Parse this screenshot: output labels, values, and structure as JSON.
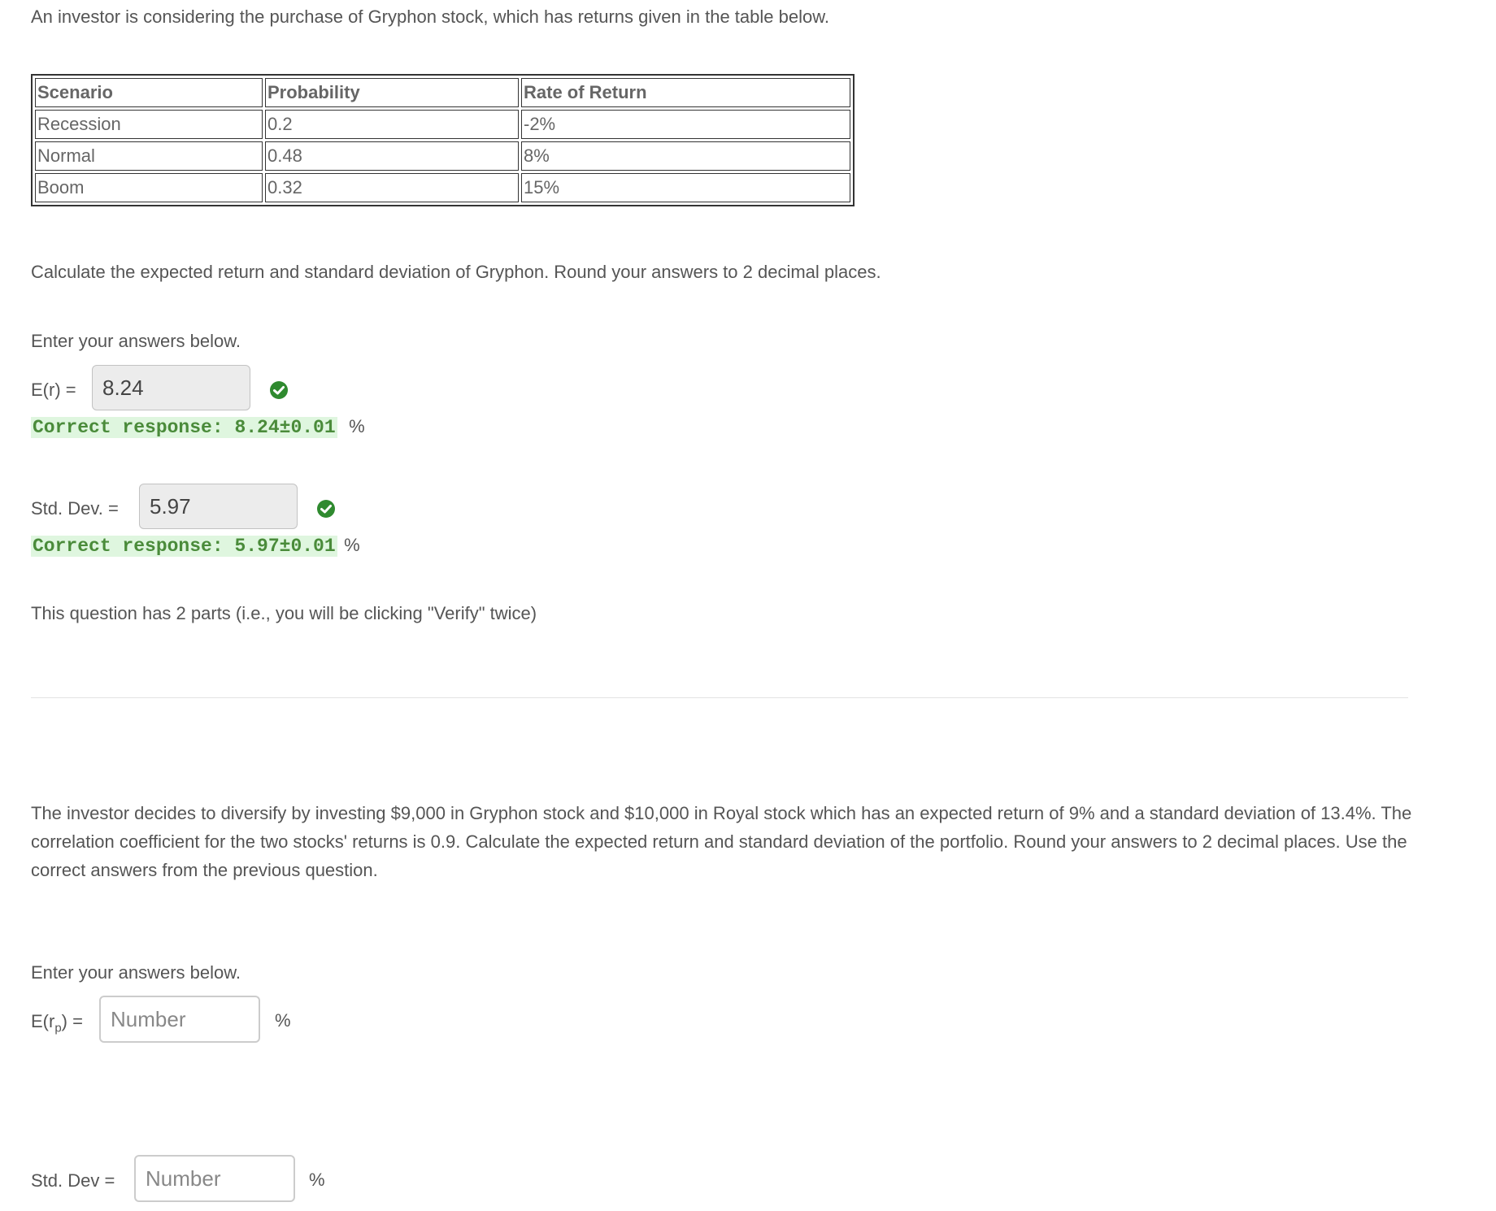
{
  "part1": {
    "intro": "An investor is considering the purchase of Gryphon stock, which has returns given in the table below.",
    "table": {
      "headers": [
        "Scenario",
        "Probability",
        "Rate of Return"
      ],
      "rows": [
        [
          "Recession",
          "0.2",
          "-2%"
        ],
        [
          "Normal",
          "0.48",
          "8%"
        ],
        [
          "Boom",
          "0.32",
          "15%"
        ]
      ]
    },
    "question": "Calculate the expected return and standard deviation of Gryphon. Round your answers to 2 decimal places.",
    "enter_label": "Enter your answers below.",
    "er": {
      "label": "E(r) =",
      "value": "8.24",
      "feedback": "Correct response: 8.24±0.01",
      "unit": "%"
    },
    "sd": {
      "label": "Std. Dev. =",
      "value": "5.97",
      "feedback": "Correct response: 5.97±0.01",
      "unit": "%"
    },
    "note": "This question has 2 parts (i.e., you will be clicking \"Verify\" twice)"
  },
  "part2": {
    "question": "The investor decides to diversify by investing $9,000 in Gryphon stock and $10,000 in Royal stock which has an expected return of 9% and a standard deviation of 13.4%. The correlation coefficient for the two stocks' returns is 0.9. Calculate the expected return and standard deviation of the portfolio. Round your answers to 2 decimal places. Use the correct answers from the previous question.",
    "enter_label": "Enter your answers below.",
    "erp": {
      "label_prefix": "E(r",
      "label_sub": "p",
      "label_suffix": ") =",
      "placeholder": "Number",
      "unit": "%"
    },
    "sd": {
      "label": "Std. Dev =",
      "placeholder": "Number",
      "unit": "%"
    }
  },
  "colors": {
    "success": "#2f8a2f",
    "feedback_bg": "#dff6df"
  }
}
